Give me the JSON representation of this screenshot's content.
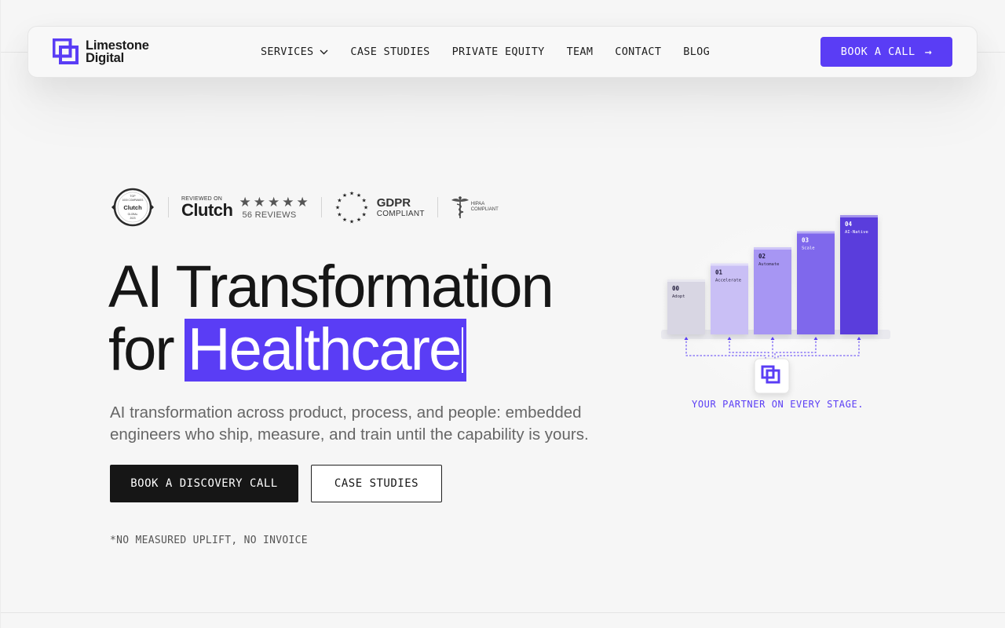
{
  "brand": {
    "name_line1": "Limestone",
    "name_line2": "Digital",
    "accent": "#5a3df5"
  },
  "nav": {
    "items": [
      {
        "label": "SERVICES",
        "has_dropdown": true
      },
      {
        "label": "CASE STUDIES"
      },
      {
        "label": "PRIVATE EQUITY"
      },
      {
        "label": "TEAM"
      },
      {
        "label": "CONTACT"
      },
      {
        "label": "BLOG"
      }
    ],
    "cta": "BOOK A CALL"
  },
  "badges": {
    "clutch_seal": {
      "top": "TOP",
      "line1": "1000 COMPANIES",
      "name": "Clutch",
      "line2": "GLOBAL",
      "year": "2023"
    },
    "clutch_review": {
      "reviewed_on": "REVIEWED ON",
      "name": "Clutch",
      "stars": 5,
      "reviews": "56 REVIEWS"
    },
    "gdpr": {
      "title": "GDPR",
      "subtitle": "COMPLIANT"
    },
    "hipaa": {
      "line1": "HIPAA",
      "line2": "COMPLIANT"
    }
  },
  "hero": {
    "title_line1": "AI Transformation",
    "title_for": "for",
    "title_highlight": "Healthcare",
    "subtitle": "AI transformation across product, process, and people: embedded engineers who ship, measure, and train until the capability is yours.",
    "primary_cta": "BOOK A DISCOVERY CALL",
    "secondary_cta": "CASE STUDIES",
    "note": "*NO MEASURED UPLIFT, NO INVOICE"
  },
  "stages": [
    {
      "num": "00",
      "label": "Adopt",
      "level": 1,
      "color": "#d8d6e3"
    },
    {
      "num": "01",
      "label": "Accelerate",
      "level": 2,
      "color": "#c9bff5"
    },
    {
      "num": "02",
      "label": "Automate",
      "level": 3,
      "color": "#a796f3"
    },
    {
      "num": "03",
      "label": "Scale",
      "level": 4,
      "color": "#7f67ec"
    },
    {
      "num": "04",
      "label": "AI-Native",
      "level": 5,
      "color": "#5a3ddc"
    }
  ],
  "partner_caption": "YOUR PARTNER ON EVERY STAGE."
}
